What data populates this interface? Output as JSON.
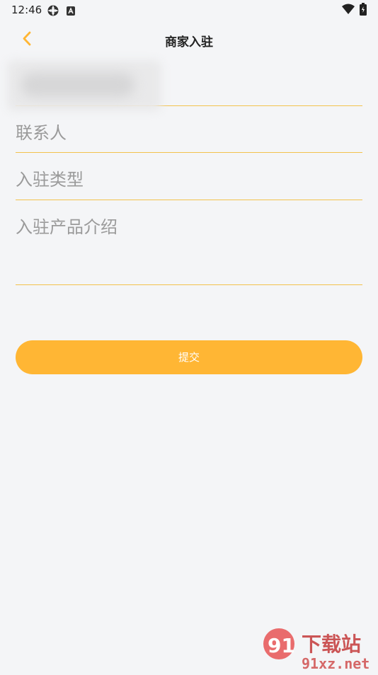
{
  "status_bar": {
    "time": "12:46"
  },
  "header": {
    "title": "商家入驻"
  },
  "form": {
    "fields": [
      {
        "placeholder": "联系人"
      },
      {
        "placeholder": "入驻类型"
      },
      {
        "placeholder": "入驻产品介绍"
      }
    ],
    "submit_label": "提交"
  },
  "watermark": {
    "text_top": "下载站",
    "text_bottom": "91xz.net"
  },
  "colors": {
    "accent": "#ffb634",
    "divider": "#f3c24d",
    "background": "#f4f5f7",
    "placeholder": "#9a9a9a"
  }
}
